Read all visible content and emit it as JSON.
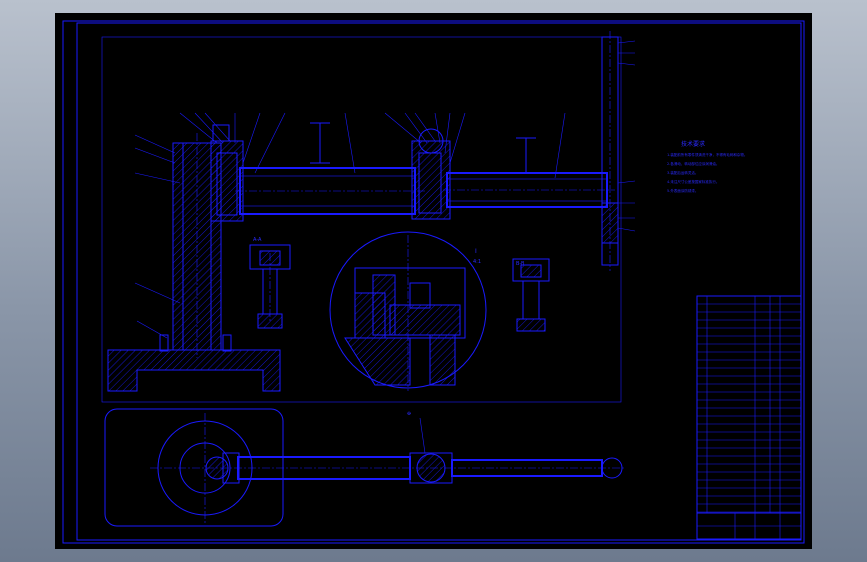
{
  "drawing": {
    "notes_title": "技术要求",
    "notes": [
      "1.装配前所有零件须清洗干净，不得有毛刺和杂物。",
      "2.各滑动、转动部位应涂润滑油。",
      "3.装配后运转灵活。",
      "4.未注尺寸公差按国家标准执行。",
      "5.外表面涂防锈漆。"
    ],
    "section_label_a": "A-A",
    "section_label_b": "B-B",
    "detail_label": "I",
    "detail_scale": "4:1"
  },
  "colors": {
    "line": "#1a1aff",
    "sheet_bg": "#000000",
    "viewer_bg_top": "#b9c1cd",
    "viewer_bg_bottom": "#6d7a8e"
  }
}
